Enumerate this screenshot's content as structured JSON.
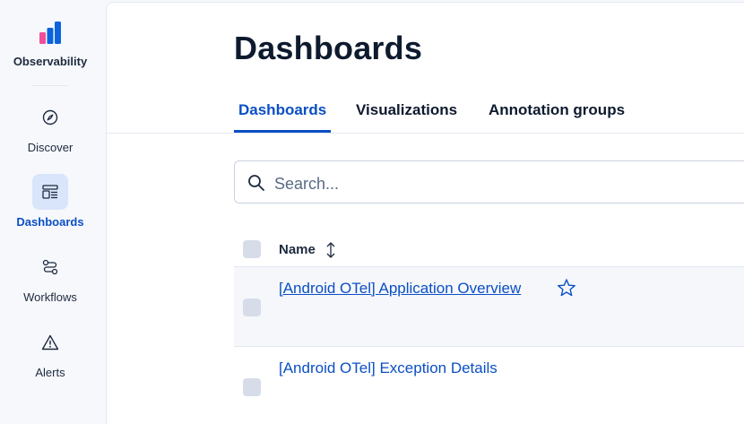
{
  "sidebar": {
    "brand": {
      "label": "Observability",
      "icon": "observability-logo"
    },
    "items": [
      {
        "label": "Discover",
        "icon": "compass-icon",
        "active": false
      },
      {
        "label": "Dashboards",
        "icon": "dashboard-icon",
        "active": true
      },
      {
        "label": "Workflows",
        "icon": "workflow-icon",
        "active": false
      },
      {
        "label": "Alerts",
        "icon": "warning-icon",
        "active": false
      }
    ]
  },
  "page": {
    "title": "Dashboards",
    "tabs": [
      {
        "label": "Dashboards",
        "active": true
      },
      {
        "label": "Visualizations",
        "active": false
      },
      {
        "label": "Annotation groups",
        "active": false
      }
    ]
  },
  "search": {
    "placeholder": "Search...",
    "value": ""
  },
  "table": {
    "columns": [
      {
        "label": "Name",
        "sortable": true
      }
    ],
    "rows": [
      {
        "name": "[Android OTel] Application Overview",
        "favorite": false
      },
      {
        "name": "[Android OTel] Exception Details",
        "favorite": false
      }
    ]
  },
  "colors": {
    "accent": "#0b4fc4",
    "brand_pink": "#f04e98",
    "brand_blue": "#0b64dd",
    "active_nav_bg": "#d9e5fb"
  }
}
